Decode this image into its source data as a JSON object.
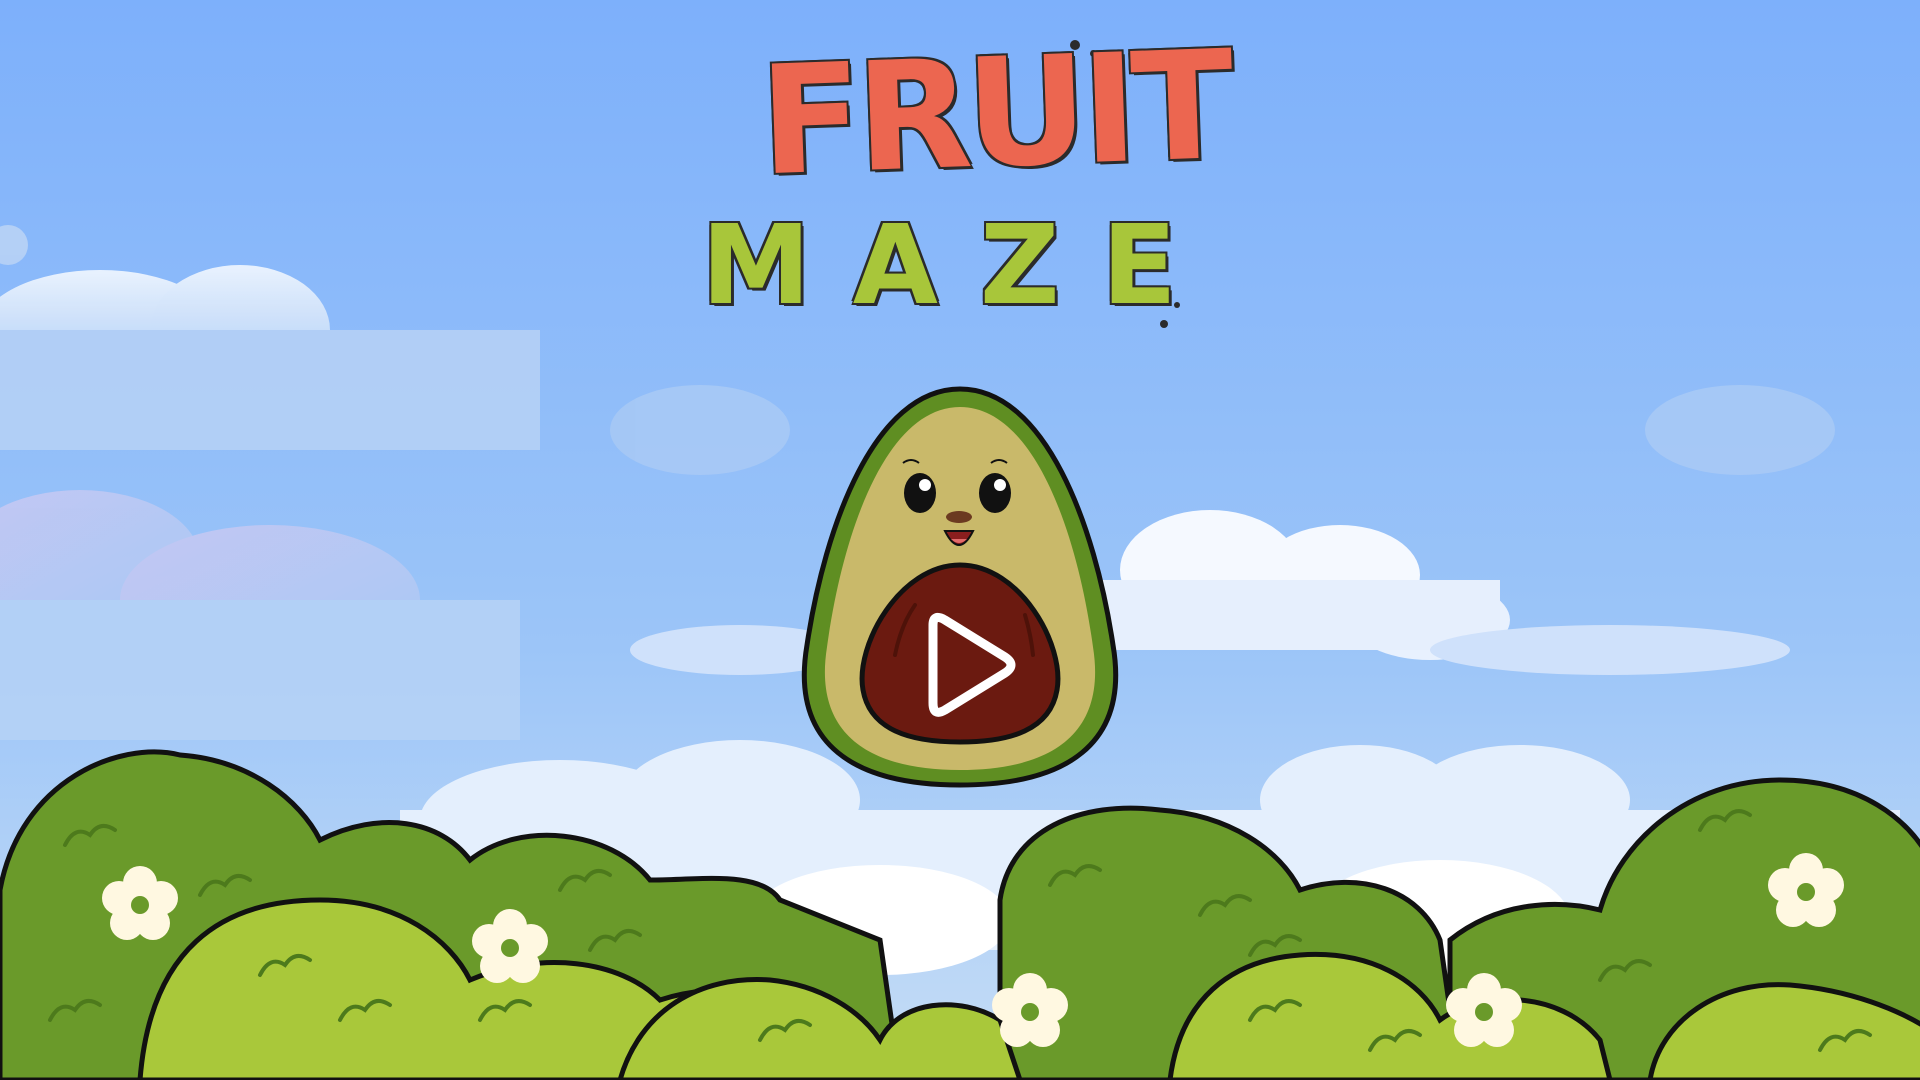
{
  "title": {
    "line1": "FRUIT",
    "line2": "MAZE"
  },
  "play_button": {
    "icon": "play-icon",
    "character": "avocado"
  },
  "colors": {
    "sky_top": "#7fb0fb",
    "sky_bottom": "#b9d6f7",
    "cloud": "#e4efff",
    "bush_dark": "#6a9a2a",
    "bush_light": "#a9c83a",
    "title_red": "#ec6650",
    "title_green": "#a8c63a",
    "avocado_skin": "#5f8e22",
    "avocado_flesh": "#c9b96a",
    "avocado_pit": "#6b1a10",
    "flower": "#fff8e1",
    "flower_center": "#6a9a2a"
  }
}
